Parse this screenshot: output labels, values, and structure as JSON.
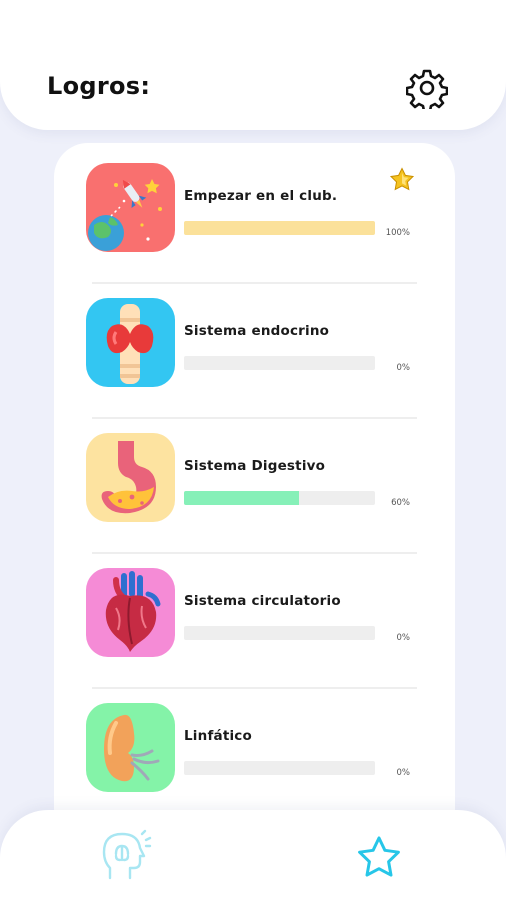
{
  "header": {
    "title": "Logros:",
    "settings_icon": "gear-icon"
  },
  "colors": {
    "background": "#eef0fa",
    "progress_yellow": "#fbe19a",
    "progress_green": "#86f0b8",
    "progress_track": "#eeeeee",
    "nav_accent": "#26c6e8"
  },
  "achievements": [
    {
      "title": "Empezar en el club.",
      "percent_label": "100%",
      "progress": 1.0,
      "icon": "space-rocket-icon",
      "tile_color": "#f9706f",
      "bar_color": "#fbe19a",
      "completed_badge": "gold-star-icon"
    },
    {
      "title": "Sistema endocrino",
      "percent_label": "0%",
      "progress": 0.0,
      "icon": "thyroid-icon",
      "tile_color": "#33c6f2",
      "bar_color": "#fbe19a"
    },
    {
      "title": "Sistema Digestivo",
      "percent_label": "60%",
      "progress": 0.6,
      "icon": "stomach-icon",
      "tile_color": "#fde3a0",
      "bar_color": "#86f0b8"
    },
    {
      "title": "Sistema circulatorio",
      "percent_label": "0%",
      "progress": 0.0,
      "icon": "heart-icon",
      "tile_color": "#f58bd6",
      "bar_color": "#fbe19a"
    },
    {
      "title": "Linfático",
      "percent_label": "0%",
      "progress": 0.0,
      "icon": "lymph-node-icon",
      "tile_color": "#84f3a8",
      "bar_color": "#fbe19a"
    }
  ],
  "bottom_nav": {
    "items": [
      "brain-head-icon",
      "star-icon"
    ]
  }
}
